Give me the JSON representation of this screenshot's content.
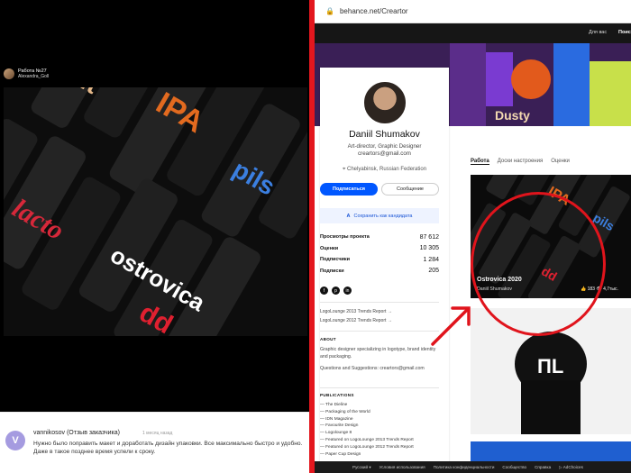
{
  "left": {
    "header": {
      "title": "Работа №27",
      "author": "Alexandra_Goll"
    },
    "review": {
      "avatar_letter": "V",
      "name": "vannikosov (Отзыв заказчика)",
      "time": "1 месяц назад",
      "text": "Нужно было поправить макет и доработать дизайн упаковки. Все максимально быстро и удобно. Даже в такое позднее время успели к сроку."
    }
  },
  "browser": {
    "lock_icon": "lock-icon",
    "url": "behance.net/Creartor"
  },
  "nav": {
    "for_you": "Для вас",
    "search": "Поис"
  },
  "profile": {
    "name": "Daniil Shumakov",
    "role": "Art-director, Graphic Designer",
    "email": "creartors@gmail.com",
    "location": "Chelyabinsk, Russian Federation",
    "subscribe_label": "Подписаться",
    "message_label": "Сообщение",
    "save_candidate_label": "Сохранить как кандидата",
    "stats": [
      {
        "label": "Просмотры проекта",
        "value": "87 612"
      },
      {
        "label": "Оценки",
        "value": "10 305"
      },
      {
        "label": "Подписчики",
        "value": "1 284"
      },
      {
        "label": "Подписки",
        "value": "205"
      }
    ],
    "socials": [
      "f",
      "p",
      "in"
    ],
    "links": [
      "LogoLounge 2013 Trends Report →",
      "LogoLounge 2012 Trends Report →"
    ],
    "about_heading": "ABOUT",
    "about_text": "Graphic designer specializing in logotype, brand identity and packaging.",
    "about_contact": "Questions and Suggestions: creartors@gmail.com",
    "pubs_heading": "PUBLICATIONS",
    "pubs": [
      "— The Dieline",
      "— Packaging of the World",
      "— IDN Magazine",
      "— Favourite Design",
      "— Logolounge 8",
      "— Featured on LogoLounge 2013 Trends Report",
      "— Featured on LogoLounge 2012 Trends Report",
      "— Paper Cup Design"
    ]
  },
  "tabs": [
    "Работа",
    "Доски настроения",
    "Оценки"
  ],
  "card1": {
    "title": "Ostrovica 2020",
    "author": "Daniil Shumakov",
    "likes": "183",
    "views": "4,7тыс."
  },
  "card2_brand": "ΠL",
  "footer": [
    "Русский ▾",
    "Условия использования",
    "Политика конфиденциальности",
    "Сообщество",
    "Справка",
    "▷ AdChoices"
  ],
  "colors": {
    "accent": "#0057ff",
    "divider": "#e3171e",
    "annotation": "#e0141c"
  }
}
